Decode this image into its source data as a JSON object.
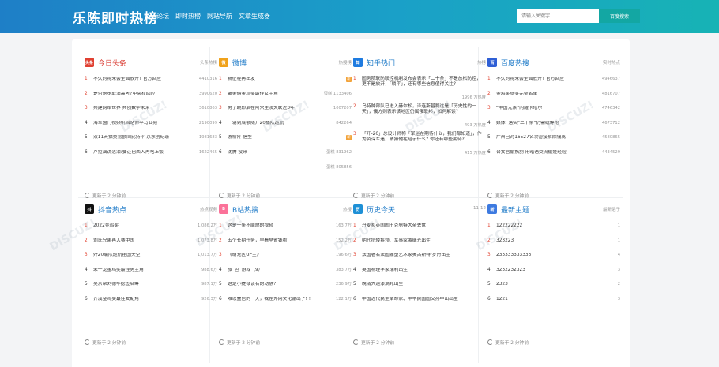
{
  "header": {
    "logo": "乐陈即时热榜",
    "nav": [
      "论坛",
      "即时热榜",
      "网站导航",
      "文章生成器"
    ],
    "search_placeholder": "请输入关键字",
    "search_button": "百度搜索"
  },
  "update_text": "更新于 2 分钟前",
  "watermark": "DISCUZ!应用中心 addon.dismall.com",
  "cards": [
    {
      "title": "今日头条",
      "sub": "头条热榜",
      "icon": "toutiao-icon",
      "icon_text": "头条",
      "items": [
        {
          "r": "1",
          "t": "不久的将来会全面放开? 官方回应",
          "n": "4410316"
        },
        {
          "r": "2",
          "t": "是否退步取消高考?中央权回应",
          "n": "3990620"
        },
        {
          "r": "3",
          "t": "共建网络世界 共创数字未来",
          "n": "3610863"
        },
        {
          "r": "4",
          "t": "海军盟门视频帆回站你平马公频",
          "n": "2190099"
        },
        {
          "r": "5",
          "t": "双11天猫交易额同比持平 京东创纪录",
          "n": "1981683"
        },
        {
          "r": "6",
          "t": "卢拉演讲落泪:要让巴西人再吃上饭",
          "n": "1622465"
        }
      ]
    },
    {
      "title": "微博",
      "sub": "热搜榜",
      "icon": "weibo-icon",
      "icon_text": "微",
      "items": [
        {
          "r": "1",
          "t": "新征程再出发",
          "n": "",
          "tag": "新"
        },
        {
          "r": "2",
          "t": "聚美俩金鸡奖最佳女主角",
          "n": "蛋糕 1133406"
        },
        {
          "r": "3",
          "t": "男子跳即后在阿穴生淡失联近3年",
          "n": "1007207"
        },
        {
          "r": "4",
          "t": "一辆到底额随开20桶队巡航",
          "n": "842264"
        },
        {
          "r": "5",
          "t": "游桥疼 信型",
          "n": "",
          "tag": "新"
        },
        {
          "r": "6",
          "t": "沈腾 没来",
          "n": "蛋糕 831962"
        },
        {
          "r": "",
          "t": "",
          "n": "蛋糕 805856"
        }
      ]
    },
    {
      "title": "知乎热门",
      "sub": "热榜",
      "icon": "zhihu-icon",
      "icon_text": "知",
      "items": [
        {
          "r": "1",
          "t": "国务院联防联控机制发布会表示「二十条」不是放松防控，更不是放开，「躺平」，还有哪些信息值得关注?",
          "n": "1996 万热度"
        },
        {
          "r": "2",
          "t": "乌特种部队已进入赫尔松，泽连斯基称这是「历史性的一天」，俄方则表示该地区仍属俄联邦，如何解读?",
          "n": "493 万热度"
        },
        {
          "r": "3",
          "t": "「歼-20」总设计师称「军迷在期待什么，我们都知道」，作为资深军迷，猜猜他在暗示什么? 你还有哪些期待?",
          "n": "415 万热度"
        }
      ]
    },
    {
      "title": "百度热搜",
      "sub": "实时热点",
      "icon": "baidu-icon",
      "icon_text": "百",
      "items": [
        {
          "r": "1",
          "t": "不久的将来会全面放开? 官方回应",
          "n": "4946637"
        },
        {
          "r": "2",
          "t": "金鸡奖获奖完整名单",
          "n": "4816707"
        },
        {
          "r": "3",
          "t": "“中国元素”闪耀卡塔尔",
          "n": "4746342"
        },
        {
          "r": "4",
          "t": "媒体: 落实“二十条”仍需统筹抢",
          "n": "4673712"
        },
        {
          "r": "5",
          "t": "广州已对16527名次密接解除隔离",
          "n": "4580865"
        },
        {
          "r": "6",
          "t": "台女官偷携割 用暗语交流偷娃经验",
          "n": "4434529"
        }
      ]
    },
    {
      "title": "抖音热点",
      "sub": "热点视频",
      "icon": "douyin-icon",
      "icon_text": "抖",
      "items": [
        {
          "r": "1",
          "t": "2022金鸡奖",
          "n": "1,086.2万"
        },
        {
          "r": "2",
          "t": "刘氏兄弟再入赛中国",
          "n": "1,073.8万"
        },
        {
          "r": "3",
          "t": "歼20编队巡航祖国天空",
          "n": "1,013.7万"
        },
        {
          "r": "4",
          "t": "朱一龙金鸡奖最佳男主角",
          "n": "988.6万"
        },
        {
          "r": "5",
          "t": "吴京帮刘德华捻签名筹",
          "n": "987.1万"
        },
        {
          "r": "6",
          "t": "齐溪金鸡奖最佳女配角",
          "n": "926.3万"
        }
      ]
    },
    {
      "title": "B站热搜",
      "sub": "热搜",
      "icon": "bilibili-icon",
      "icon_text": "B",
      "items": [
        {
          "r": "1",
          "t": "这是一条不能燃的视频",
          "n": "163.7万"
        },
        {
          "r": "2",
          "t": "五个长期任务，早看早省钱啦!",
          "n": "152.2万"
        },
        {
          "r": "3",
          "t": "《萌宠区UP主》",
          "n": "196.6万"
        },
        {
          "r": "4",
          "t": "旅“色”游戏（9）",
          "n": "383.7万"
        },
        {
          "r": "5",
          "t": "这是小提琴该有的动静?",
          "n": "236.9万"
        },
        {
          "r": "6",
          "t": "难以置信的一天，我在外网文化输出了! !",
          "n": "122.1万"
        }
      ]
    },
    {
      "title": "历史今天",
      "sub": "11-12",
      "icon": "history-icon",
      "icon_text": "历",
      "items": [
        {
          "r": "1",
          "t": "丹麦和英国国王克努特大帝去世",
          "n": ""
        },
        {
          "r": "2",
          "t": "明代抗倭将领、军事家戚继光出生",
          "n": ""
        },
        {
          "r": "3",
          "t": "法国著名法国雕塑艺术家奥古斯特·罗丹出生",
          "n": ""
        },
        {
          "r": "4",
          "t": "英国物理学家瑞利出生",
          "n": ""
        },
        {
          "r": "5",
          "t": "晚清大运漆满死出生",
          "n": ""
        },
        {
          "r": "6",
          "t": "中国近代民主革命家、中华民国国父孙中山出生",
          "n": ""
        }
      ]
    },
    {
      "title": "最新主题",
      "sub": "最新贴子",
      "icon": "topics-icon",
      "icon_text": "新",
      "items": [
        {
          "r": "1",
          "t": "122222222",
          "n": "1"
        },
        {
          "r": "2",
          "t": "323223",
          "n": "1"
        },
        {
          "r": "3",
          "t": "233333333333",
          "n": "4"
        },
        {
          "r": "4",
          "t": "3232232323",
          "n": "3"
        },
        {
          "r": "5",
          "t": "2323",
          "n": "2"
        },
        {
          "r": "6",
          "t": "1221",
          "n": "3"
        }
      ]
    }
  ]
}
